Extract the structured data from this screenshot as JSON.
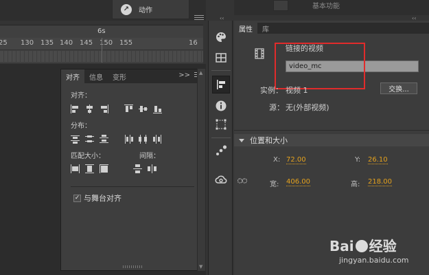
{
  "action_panel": {
    "label": "动作"
  },
  "timeline": {
    "time_marker": "6s",
    "ruler": [
      "25",
      "130",
      "135",
      "140",
      "145",
      "150",
      "155",
      "16"
    ]
  },
  "align_panel": {
    "tabs": [
      "对齐",
      "信息",
      "变形"
    ],
    "active_tab": "对齐",
    "expand_label": ">>",
    "sections": {
      "align": "对齐：",
      "distribute": "分布：",
      "match_size": "匹配大小：",
      "spacing": "间隔："
    },
    "align_to_stage": {
      "label": "与舞台对齐",
      "checked": true,
      "check_mark": "✓"
    }
  },
  "toolbar": {
    "collapse_label": "‹‹",
    "tools": [
      "palette-icon",
      "grid-swatches-icon",
      "align-icon",
      "info-icon",
      "transform-icon",
      "motion-presets-icon",
      "creative-cloud-icon"
    ],
    "selected_tool": "align-icon"
  },
  "properties": {
    "collapse_label": "‹‹",
    "tabs": [
      "属性",
      "库"
    ],
    "active_tab": "属性",
    "top_ghost_text": "基本功能",
    "link_label": "链接的视频",
    "instance_name": "video_mc",
    "instance_label": "实例：",
    "instance_value": "视频 1",
    "swap_label": "交换...",
    "source_label": "源：",
    "source_value": "无(外部视频)",
    "position_section": {
      "title": "位置和大小",
      "x_label": "X:",
      "x_value": "72.00",
      "y_label": "Y:",
      "y_value": "26.10",
      "width_label": "宽:",
      "width_value": "406.00",
      "height_label": "高:",
      "height_value": "218.00"
    }
  },
  "watermark": {
    "logo_left": "Bai",
    "logo_right": "经验",
    "url": "jingyan.baidu.com"
  },
  "colors": {
    "accent_value": "#e5a21d",
    "highlight_box": "#e12b2b",
    "panel_bg": "#3c3c3c"
  }
}
